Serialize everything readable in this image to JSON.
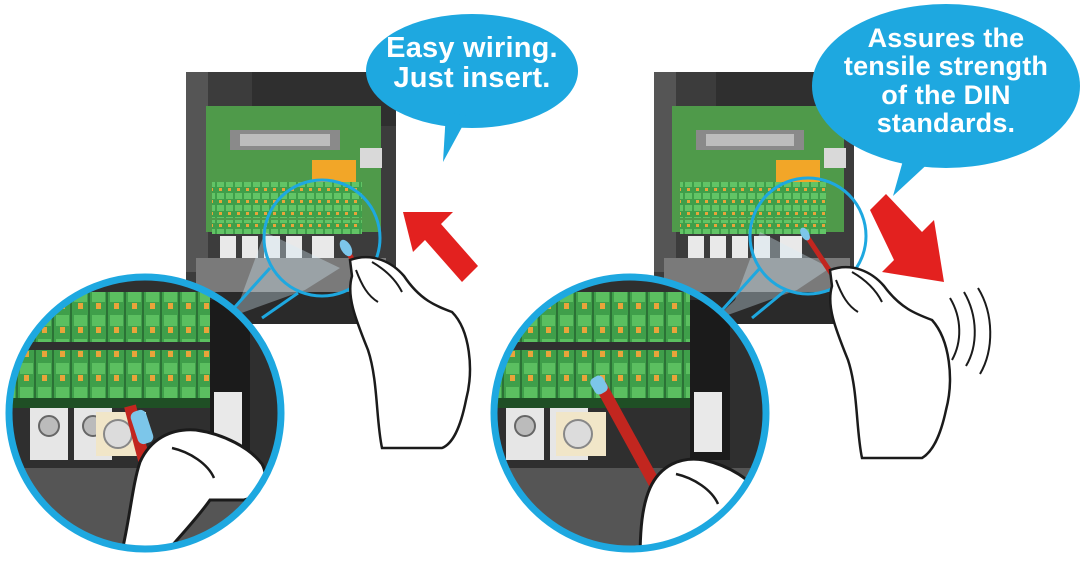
{
  "panels": [
    {
      "id": "insert",
      "callout_lines": [
        "Easy wiring.",
        "Just insert."
      ]
    },
    {
      "id": "tensile",
      "callout_lines": [
        "Assures the",
        "tensile strength",
        "of the DIN",
        "standards."
      ]
    }
  ],
  "colors": {
    "callout_fill": "#1ea8e0",
    "callout_text": "#ffffff",
    "arrow": "#e3211f",
    "device_body": "#3c3c3c",
    "pcb": "#4f9a4a",
    "terminal_green": "#3f9f4a",
    "terminal_orange": "#e9a43a",
    "wire_red": "#c2261f",
    "ferrule_blue": "#7cc6ea",
    "hand_skin": "#ffffff",
    "zoom_ring": "#1ea8e0"
  },
  "icons": [
    "device-illustration",
    "zoom-lens",
    "hand-illustration",
    "direction-arrow",
    "vibration-lines"
  ]
}
